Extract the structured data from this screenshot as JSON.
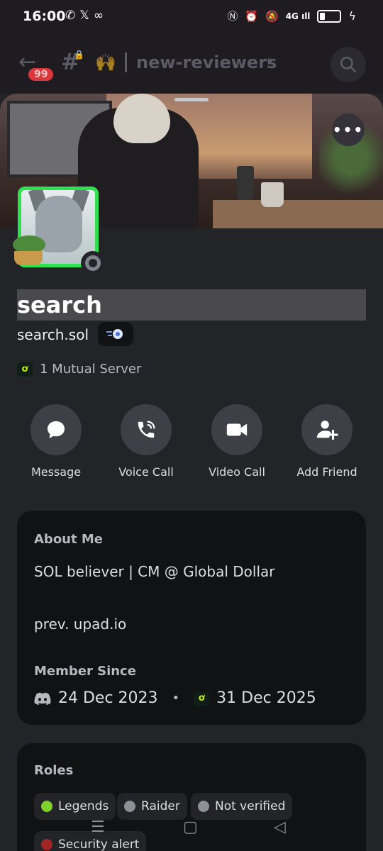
{
  "status_bar": {
    "time": "16:00",
    "network": "4G",
    "left_icons": [
      "whatsapp-icon",
      "x-icon",
      "voicemail-icon"
    ],
    "right_icons": [
      "nfc-icon",
      "alarm-icon",
      "mute-icon",
      "signal-icon",
      "battery-icon",
      "charging-icon"
    ]
  },
  "top_bar": {
    "badge_count": "99",
    "channel_emoji": "🙌",
    "channel_name": "new-reviewers"
  },
  "profile": {
    "display_name": "search",
    "username": "search.sol",
    "mutual_servers": "1 Mutual Server",
    "status": "offline"
  },
  "actions": [
    {
      "label": "Message",
      "icon": "chat-bubble-icon"
    },
    {
      "label": "Voice Call",
      "icon": "phone-icon"
    },
    {
      "label": "Video Call",
      "icon": "video-camera-icon"
    },
    {
      "label": "Add Friend",
      "icon": "add-friend-icon"
    }
  ],
  "about": {
    "title": "About Me",
    "line1": "SOL believer | CM @ Global Dollar",
    "line2": "prev. upad.io",
    "member_since_title": "Member Since",
    "discord_date": "24 Dec 2023",
    "server_date": "31 Dec 2025",
    "separator": "•"
  },
  "roles": {
    "title": "Roles",
    "items": [
      {
        "name": "Legends",
        "color": "#7fd12e"
      },
      {
        "name": "Raider",
        "color": "#8c9196"
      },
      {
        "name": "Not verified",
        "color": "#8c9196"
      },
      {
        "name": "Security alert",
        "color": "#a02626"
      }
    ]
  },
  "colors": {
    "accent_green": "#2fe04f",
    "badge_red": "#da373c",
    "background": "#232428",
    "card": "#111214"
  }
}
